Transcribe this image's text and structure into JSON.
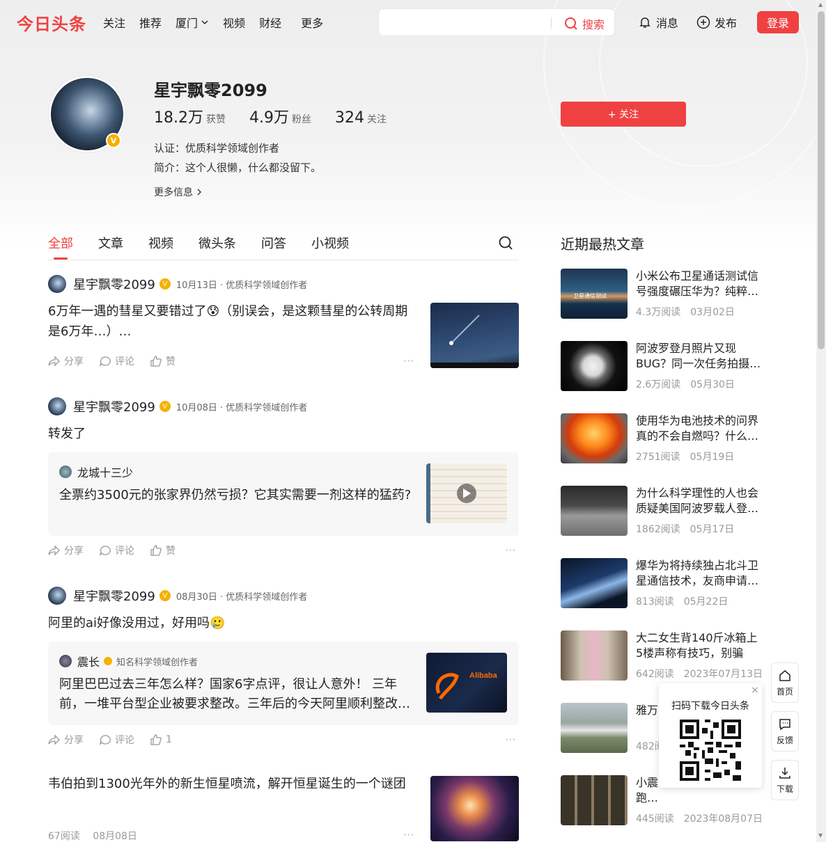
{
  "nav": {
    "logo": "今日头条",
    "links": [
      "关注",
      "推荐",
      "厦门",
      "视频",
      "财经"
    ],
    "more": "更多",
    "search_button": "搜索",
    "search_placeholder": "",
    "messages": "消息",
    "publish": "发布",
    "login": "登录"
  },
  "profile": {
    "name": "星宇飘零2099",
    "likes_value": "18.2万",
    "likes_label": "获赞",
    "fans_value": "4.9万",
    "fans_label": "粉丝",
    "following_value": "324",
    "following_label": "关注",
    "cert": "认证：优质科学领域创作者",
    "bio": "简介：这个人很懒，什么都没留下。",
    "more_info": "更多信息",
    "follow_button": "+ 关注",
    "badge": "V"
  },
  "tabs": [
    "全部",
    "文章",
    "视频",
    "微头条",
    "问答",
    "小视频"
  ],
  "feed": [
    {
      "author": "星宇飘零2099",
      "meta": "10月13日 · 优质科学领域创作者",
      "text": "6万年一遇的彗星又要错过了😰（别误会，是这颗彗星的公转周期是6万年…）…",
      "share": "分享",
      "comment": "评论",
      "like": "赞"
    },
    {
      "author": "星宇飘零2099",
      "meta": "10月08日 · 优质科学领域创作者",
      "text": "转发了",
      "quote_author": "龙城十三少",
      "quote_text": "全票约3500元的张家界仍然亏损？它其实需要一剂这样的猛药?",
      "share": "分享",
      "comment": "评论",
      "like": "赞"
    },
    {
      "author": "星宇飘零2099",
      "meta": "08月30日 · 优质科学领域创作者",
      "text": "阿里的ai好像没用过，好用吗🥲",
      "quote_author": "震长",
      "quote_meta": "知名科学领域创作者",
      "quote_text": "阿里巴巴过去三年怎么样？国家6字点评，很让人意外！ 三年前，一堆平台型企业被要求整改。三年后的今天阿里顺利整改…",
      "quote_image_text": "Alibaba",
      "share": "分享",
      "comment": "评论",
      "like": "1"
    },
    {
      "title": "韦伯拍到1300光年外的新生恒星喷流，解开恒星诞生的一个谜团",
      "reads": "67阅读",
      "date": "08月08日"
    }
  ],
  "sidebar": {
    "title": "近期最热文章",
    "items": [
      {
        "title": "小米公布卫星通话测试信号强度碾压华为？纯粹…",
        "reads": "4.3万阅读",
        "date": "03月02日",
        "thumb_text": "卫星通信测试"
      },
      {
        "title": "阿波罗登月照片又现BUG？同一次任务拍摄…",
        "reads": "2.6万阅读",
        "date": "05月30日"
      },
      {
        "title": "使用华为电池技术的问界真的不会自燃吗？什么…",
        "reads": "2751阅读",
        "date": "05月19日"
      },
      {
        "title": "为什么科学理性的人也会质疑美国阿波罗载人登…",
        "reads": "1862阅读",
        "date": "05月17日"
      },
      {
        "title": "爆华为将持续独占北斗卫星通信技术，友商申请…",
        "reads": "813阅读",
        "date": "05月22日"
      },
      {
        "title": "大二女生背140斤冰箱上5楼声称有技巧，别骗我…",
        "reads": "642阅读",
        "date": "2023年07月13日"
      },
      {
        "title": "雅万…狂魔…",
        "reads": "482阅读",
        "date": ""
      },
      {
        "title": "小震…了？别傻了，赶紧跑…",
        "reads": "445阅读",
        "date": "2023年08月07日"
      }
    ]
  },
  "floating": {
    "home": "首页",
    "feedback": "反馈",
    "download": "下载",
    "qr_title": "扫码下载今日头条",
    "qr_close": "×"
  },
  "colors": {
    "accent": "#f04142",
    "badge": "#f5b100"
  }
}
